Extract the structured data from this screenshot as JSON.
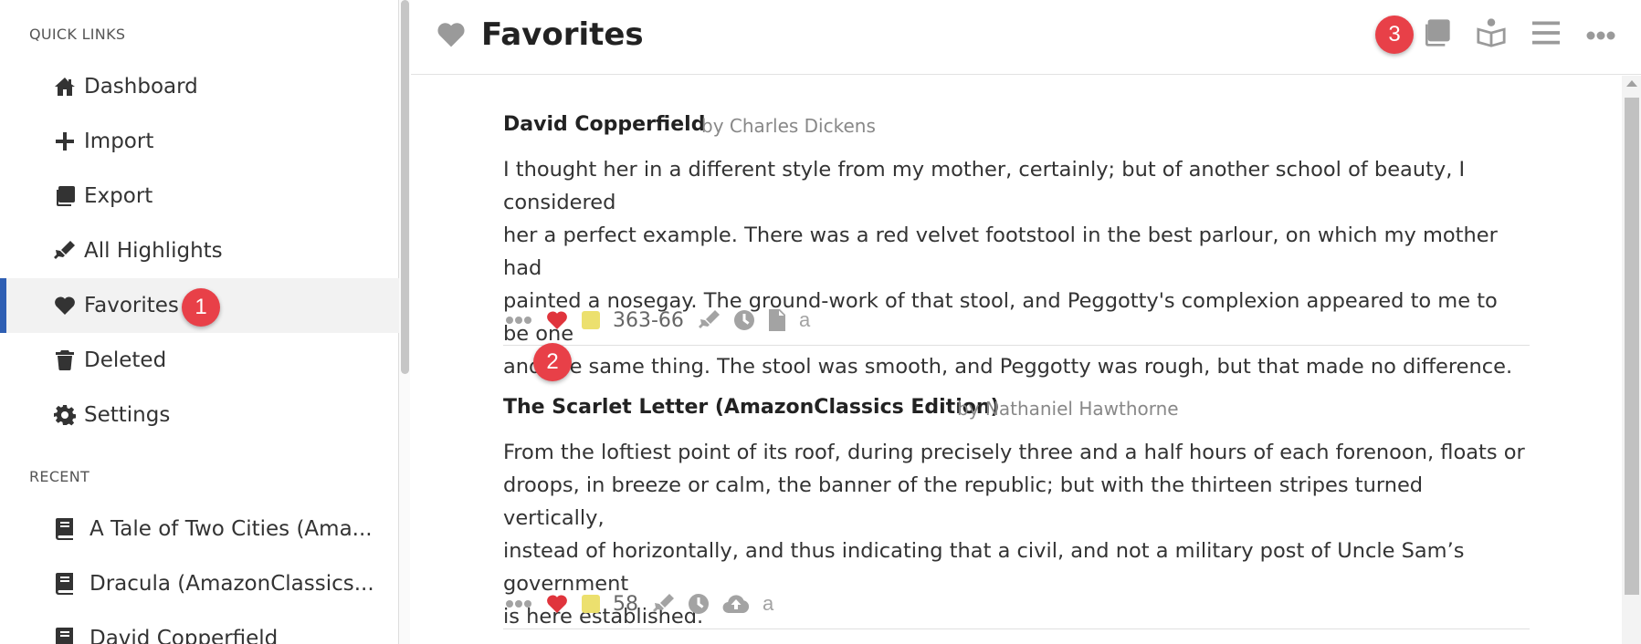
{
  "sidebar": {
    "quick_links_label": "QUICK LINKS",
    "items": [
      {
        "label": "Dashboard",
        "icon": "home-icon"
      },
      {
        "label": "Import",
        "icon": "plus-icon"
      },
      {
        "label": "Export",
        "icon": "copy-icon"
      },
      {
        "label": "All Highlights",
        "icon": "highlighter-icon"
      },
      {
        "label": "Favorites",
        "icon": "heart-icon",
        "active": true
      },
      {
        "label": "Deleted",
        "icon": "trash-icon"
      },
      {
        "label": "Settings",
        "icon": "gear-icon"
      }
    ],
    "recent_label": "RECENT",
    "recent": [
      {
        "label": "A Tale of Two Cities (Ama...",
        "icon": "book-icon"
      },
      {
        "label": "Dracula (AmazonClassics...",
        "icon": "book-icon"
      },
      {
        "label": "David Copperfield",
        "icon": "book-icon"
      }
    ]
  },
  "header": {
    "title": "Favorites",
    "icon": "heart-icon",
    "actions": [
      "copy-icon",
      "open-book-icon",
      "list-icon",
      "more-icon"
    ]
  },
  "entries": [
    {
      "title": "David Copperfield",
      "author": "by Charles Dickens",
      "lines": [
        "I thought her in a different style from my mother, certainly; but of another school of beauty, I considered",
        "her a perfect example. There was a red velvet footstool in the best parlour, on which my mother had",
        "painted a nosegay. The ground-work of that stool, and Peggotty's complexion appeared to me to be one",
        "and the same thing. The stool was smooth, and Peggotty was rough, but that made no difference."
      ],
      "location": "363-66",
      "extra_icon": "file-icon"
    },
    {
      "title": "The Scarlet Letter (AmazonClassics Edition)",
      "author": "by Nathaniel Hawthorne",
      "lines": [
        "From the loftiest point of its roof, during precisely three and a half hours of each forenoon, floats or",
        "droops, in breeze or calm, the banner of the republic; but with the thirteen stripes turned vertically,",
        "instead of horizontally, and thus indicating that a civil, and not a military post of Uncle Sam’s government",
        "is here established."
      ],
      "location": "58",
      "extra_icon": "cloud-upload-icon"
    }
  ],
  "badges": [
    "1",
    "2",
    "3"
  ],
  "colors": {
    "accent": "#2f5fb3",
    "heart": "#e0343c",
    "badge": "#e84048",
    "highlight": "#ece06e"
  }
}
